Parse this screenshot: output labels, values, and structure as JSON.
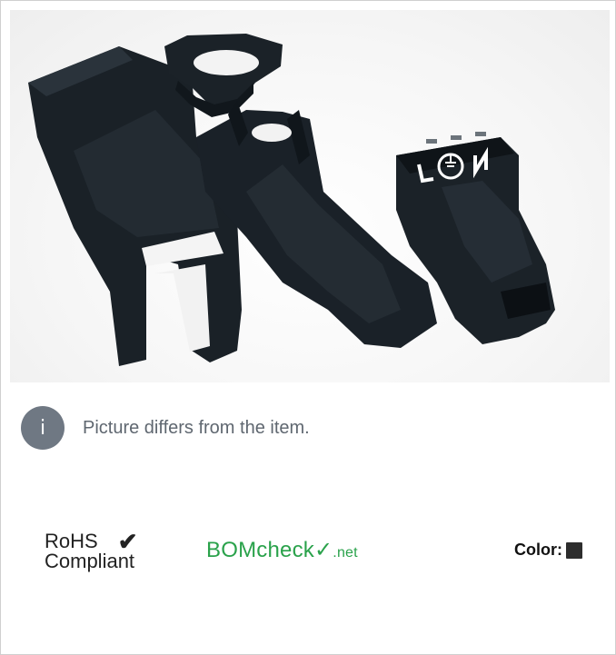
{
  "notice": {
    "icon_glyph": "i",
    "text": "Picture differs from the item."
  },
  "rohs": {
    "line1": "RoHS",
    "line2": "Compliant",
    "check_glyph": "✔"
  },
  "bomcheck": {
    "part1": "BOM",
    "part2": "check",
    "check_glyph": "✓",
    "part3": ".net"
  },
  "color": {
    "label": "Color:",
    "swatch_hex": "#2d2d2d"
  },
  "colors": {
    "product_body": "#1c232a",
    "product_shadow": "#0d1216",
    "info_icon_bg": "#6f7883",
    "bom_green": "#2aa24b"
  }
}
